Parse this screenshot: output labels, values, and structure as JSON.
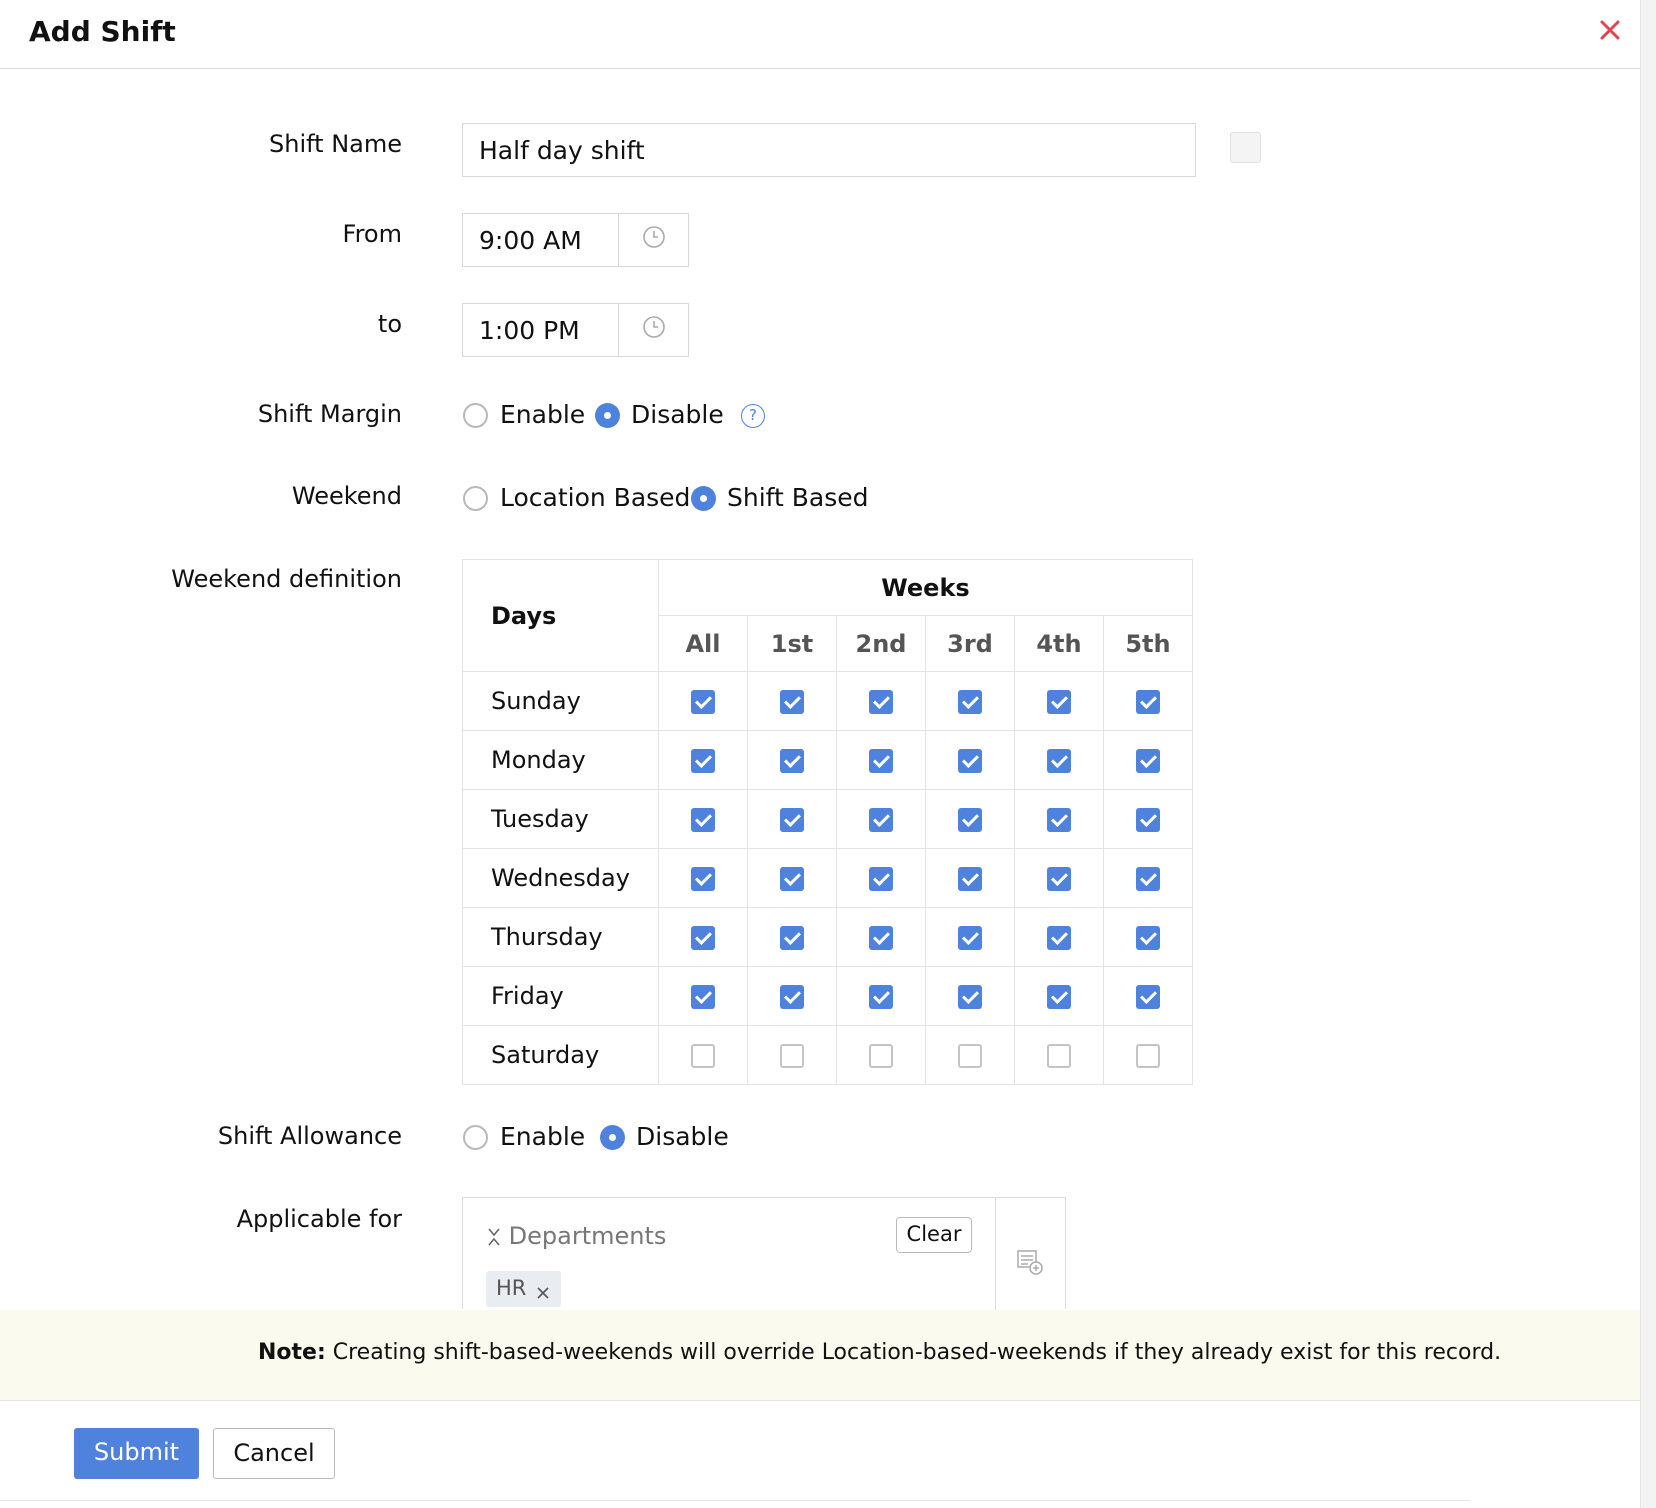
{
  "dialog": {
    "title": "Add Shift"
  },
  "form": {
    "shift_name": {
      "label": "Shift Name",
      "value": "Half day shift"
    },
    "from": {
      "label": "From",
      "value": "9:00 AM"
    },
    "to": {
      "label": "to",
      "value": "1:00 PM"
    },
    "shift_margin": {
      "label": "Shift Margin",
      "options": [
        "Enable",
        "Disable"
      ],
      "selected": "Disable"
    },
    "weekend": {
      "label": "Weekend",
      "options": [
        "Location Based",
        "Shift Based"
      ],
      "selected": "Shift Based"
    },
    "weekend_definition": {
      "label": "Weekend definition",
      "days_header": "Days",
      "weeks_header": "Weeks",
      "week_columns": [
        "All",
        "1st",
        "2nd",
        "3rd",
        "4th",
        "5th"
      ],
      "rows": [
        {
          "day": "Sunday",
          "checked": [
            true,
            true,
            true,
            true,
            true,
            true
          ]
        },
        {
          "day": "Monday",
          "checked": [
            true,
            true,
            true,
            true,
            true,
            true
          ]
        },
        {
          "day": "Tuesday",
          "checked": [
            true,
            true,
            true,
            true,
            true,
            true
          ]
        },
        {
          "day": "Wednesday",
          "checked": [
            true,
            true,
            true,
            true,
            true,
            true
          ]
        },
        {
          "day": "Thursday",
          "checked": [
            true,
            true,
            true,
            true,
            true,
            true
          ]
        },
        {
          "day": "Friday",
          "checked": [
            true,
            true,
            true,
            true,
            true,
            true
          ]
        },
        {
          "day": "Saturday",
          "checked": [
            false,
            false,
            false,
            false,
            false,
            false
          ]
        }
      ]
    },
    "shift_allowance": {
      "label": "Shift Allowance",
      "options": [
        "Enable",
        "Disable"
      ],
      "selected": "Disable"
    },
    "applicable_for": {
      "label": "Applicable for",
      "type": "Departments",
      "clear_label": "Clear",
      "chips": [
        "HR"
      ]
    }
  },
  "note": {
    "prefix": "Note:",
    "text": " Creating shift-based-weekends will override Location-based-weekends if they already exist for this record."
  },
  "actions": {
    "submit": "Submit",
    "cancel": "Cancel"
  },
  "colors": {
    "accent": "#4f82dd",
    "close": "#e0444f",
    "note_bg": "#fafaef"
  },
  "icons": [
    "close-icon",
    "clock-icon",
    "help-icon",
    "collapse-icon",
    "remove-chip-icon",
    "add-list-icon"
  ]
}
